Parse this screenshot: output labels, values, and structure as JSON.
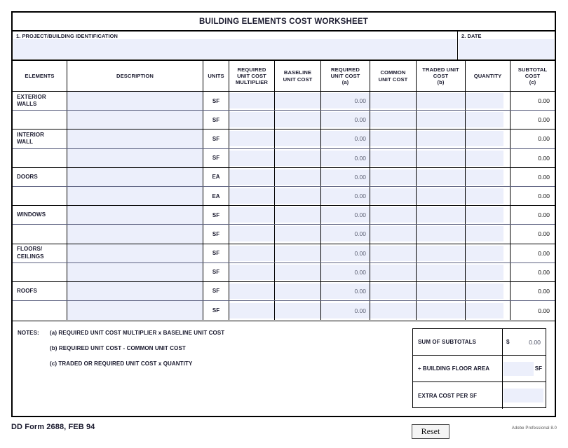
{
  "form": {
    "title": "BUILDING ELEMENTS COST WORKSHEET",
    "form_id": "DD Form 2688, FEB 94",
    "producer_tag": "Adobe Professional 8.0",
    "reset_label": "Reset",
    "field_fill_color": "#eceffb",
    "border_color": "#000000"
  },
  "identification": {
    "project": {
      "label": "1.  PROJECT/BUILDING IDENTIFICATION",
      "value": "",
      "placeholder": ""
    },
    "date": {
      "label": "2.  DATE",
      "value": "",
      "placeholder": ""
    }
  },
  "columns": [
    {
      "key": "elements",
      "label": "ELEMENTS"
    },
    {
      "key": "description",
      "label": "DESCRIPTION"
    },
    {
      "key": "units",
      "label": "UNITS"
    },
    {
      "key": "required_unit_cost_multiplier",
      "label": "REQUIRED\nUNIT COST\nMULTIPLIER"
    },
    {
      "key": "baseline_unit_cost",
      "label": "BASELINE\nUNIT COST"
    },
    {
      "key": "required_unit_cost",
      "label": "REQUIRED\nUNIT COST\n(a)"
    },
    {
      "key": "common_unit_cost",
      "label": "COMMON\nUNIT COST"
    },
    {
      "key": "traded_unit_cost",
      "label": "TRADED UNIT\nCOST\n(b)"
    },
    {
      "key": "quantity",
      "label": "QUANTITY"
    },
    {
      "key": "subtotal_cost",
      "label": "SUBTOTAL\nCOST\n(c)"
    }
  ],
  "groups": [
    {
      "element": "EXTERIOR\nWALLS",
      "rows": [
        {
          "description": "",
          "units": "SF",
          "rucm": "",
          "baseline": "",
          "ruc": "0.00",
          "common": "",
          "traded": "",
          "quantity": "",
          "subtotal": "0.00"
        },
        {
          "description": "",
          "units": "SF",
          "rucm": "",
          "baseline": "",
          "ruc": "0.00",
          "common": "",
          "traded": "",
          "quantity": "",
          "subtotal": "0.00"
        }
      ]
    },
    {
      "element": "INTERIOR\nWALL",
      "rows": [
        {
          "description": "",
          "units": "SF",
          "rucm": "",
          "baseline": "",
          "ruc": "0.00",
          "common": "",
          "traded": "",
          "quantity": "",
          "subtotal": "0.00"
        },
        {
          "description": "",
          "units": "SF",
          "rucm": "",
          "baseline": "",
          "ruc": "0.00",
          "common": "",
          "traded": "",
          "quantity": "",
          "subtotal": "0.00"
        }
      ]
    },
    {
      "element": "DOORS",
      "rows": [
        {
          "description": "",
          "units": "EA",
          "rucm": "",
          "baseline": "",
          "ruc": "0.00",
          "common": "",
          "traded": "",
          "quantity": "",
          "subtotal": "0.00"
        },
        {
          "description": "",
          "units": "EA",
          "rucm": "",
          "baseline": "",
          "ruc": "0.00",
          "common": "",
          "traded": "",
          "quantity": "",
          "subtotal": "0.00"
        }
      ]
    },
    {
      "element": "WINDOWS",
      "rows": [
        {
          "description": "",
          "units": "SF",
          "rucm": "",
          "baseline": "",
          "ruc": "0.00",
          "common": "",
          "traded": "",
          "quantity": "",
          "subtotal": "0.00"
        },
        {
          "description": "",
          "units": "SF",
          "rucm": "",
          "baseline": "",
          "ruc": "0.00",
          "common": "",
          "traded": "",
          "quantity": "",
          "subtotal": "0.00"
        }
      ]
    },
    {
      "element": "FLOORS/\nCEILINGS",
      "rows": [
        {
          "description": "",
          "units": "SF",
          "rucm": "",
          "baseline": "",
          "ruc": "0.00",
          "common": "",
          "traded": "",
          "quantity": "",
          "subtotal": "0.00"
        },
        {
          "description": "",
          "units": "SF",
          "rucm": "",
          "baseline": "",
          "ruc": "0.00",
          "common": "",
          "traded": "",
          "quantity": "",
          "subtotal": "0.00"
        }
      ]
    },
    {
      "element": "ROOFS",
      "rows": [
        {
          "description": "",
          "units": "SF",
          "rucm": "",
          "baseline": "",
          "ruc": "0.00",
          "common": "",
          "traded": "",
          "quantity": "",
          "subtotal": "0.00"
        },
        {
          "description": "",
          "units": "SF",
          "rucm": "",
          "baseline": "",
          "ruc": "0.00",
          "common": "",
          "traded": "",
          "quantity": "",
          "subtotal": "0.00"
        }
      ]
    }
  ],
  "notes": {
    "heading": "NOTES:",
    "items": [
      "(a) REQUIRED UNIT COST MULTIPLIER x BASELINE UNIT COST",
      "(b) REQUIRED UNIT COST - COMMON UNIT COST",
      "(c) TRADED OR REQUIRED UNIT COST x QUANTITY"
    ]
  },
  "summary": {
    "sum_of_subtotals": {
      "label": "SUM OF SUBTOTALS",
      "currency": "$",
      "value": "0.00"
    },
    "building_floor_area": {
      "label": "÷ BUILDING FLOOR AREA",
      "value": "",
      "unit": "SF"
    },
    "extra_cost_per_sf": {
      "label": "EXTRA COST PER SF",
      "value": ""
    }
  }
}
